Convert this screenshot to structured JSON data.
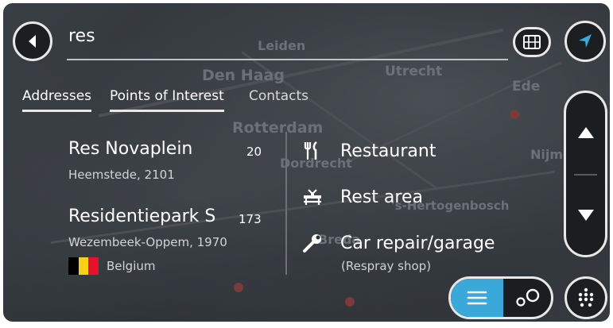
{
  "search": {
    "query": "res"
  },
  "tabs": [
    {
      "label": "Addresses"
    },
    {
      "label": "Points of Interest"
    },
    {
      "label": "Contacts"
    }
  ],
  "map_labels": [
    "Leiden",
    "Den Haag",
    "Utrecht",
    "Ede",
    "Rotterdam",
    "Dordrecht",
    "Nijmegen",
    "'s-Hertogenbosch",
    "Breda"
  ],
  "results": [
    {
      "name": "Res Novaplein",
      "distance": "20",
      "location": "Heemstede, 2101",
      "country": ""
    },
    {
      "name": "Residentiepark S",
      "distance": "173",
      "location": "Wezembeek-Oppem, 1970",
      "country": "Belgium"
    }
  ],
  "categories": [
    {
      "label": "Restaurant",
      "icon": "fork-knife-icon"
    },
    {
      "label": "Rest area",
      "icon": "rest-area-icon"
    },
    {
      "label": "Car repair/garage",
      "icon": "wrench-icon",
      "sublabel": "(Respray shop)"
    }
  ],
  "colors": {
    "accent": "#3aa8d8",
    "background": "#2e3236",
    "text": "#ffffff",
    "flag_black": "#000000",
    "flag_yellow": "#f7d117",
    "flag_red": "#e8112d"
  }
}
